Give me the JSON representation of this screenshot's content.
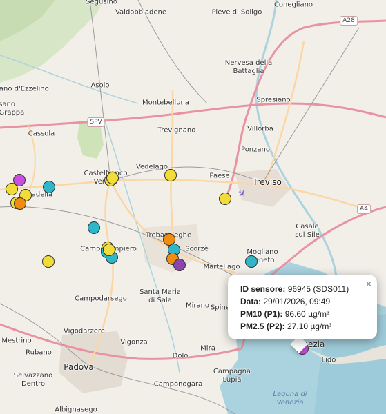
{
  "places": [
    {
      "name": "Segusino"
    },
    {
      "name": "Valdobbiadene"
    },
    {
      "name": "Pieve di Soligo"
    },
    {
      "name": "Conegliano"
    },
    {
      "name": "rmano d'Ezzelino"
    },
    {
      "name": "Asolo"
    },
    {
      "name": "Nervesa della Battaglia"
    },
    {
      "name": "Bassano del Grappa"
    },
    {
      "name": "Montebelluna"
    },
    {
      "name": "Spresiano"
    },
    {
      "name": "Cassola"
    },
    {
      "name": "Trevignano"
    },
    {
      "name": "Villorba"
    },
    {
      "name": "Ponzano"
    },
    {
      "name": "Vedelago"
    },
    {
      "name": "Castelfranco Veneto"
    },
    {
      "name": "Paese"
    },
    {
      "name": "Treviso"
    },
    {
      "name": "ttadella"
    },
    {
      "name": "Casale sul Sile"
    },
    {
      "name": "Trebaseleghe"
    },
    {
      "name": "Camposampiero"
    },
    {
      "name": "Scorzè"
    },
    {
      "name": "Mogliano Veneto"
    },
    {
      "name": "Martellago"
    },
    {
      "name": "Santa Maria di Sala"
    },
    {
      "name": "Campodarsego"
    },
    {
      "name": "Mirano"
    },
    {
      "name": "Spinea"
    },
    {
      "name": "Vigodarzere"
    },
    {
      "name": "Vigonza"
    },
    {
      "name": "Dolo"
    },
    {
      "name": "Mira"
    },
    {
      "name": "Mestrino"
    },
    {
      "name": "Rubano"
    },
    {
      "name": "Padova"
    },
    {
      "name": "Selvazzano Dentro"
    },
    {
      "name": "Campagna Lupia"
    },
    {
      "name": "Camponogara"
    },
    {
      "name": "Venezia"
    },
    {
      "name": "Lido"
    },
    {
      "name": "Albignasego"
    },
    {
      "name": "Laguna di Venezia"
    }
  ],
  "road_shields": [
    "A28",
    "SPV",
    "A4"
  ],
  "colors": {
    "yellow": "#f2dc3a",
    "orange": "#f28c0f",
    "cyan": "#2fb7c9",
    "magenta": "#c84fe0",
    "purple": "#8e44ad",
    "water": "#aad3df"
  },
  "markers": [
    {
      "color": "magenta"
    },
    {
      "color": "yellow"
    },
    {
      "color": "yellow"
    },
    {
      "color": "yellow"
    },
    {
      "color": "orange"
    },
    {
      "color": "cyan"
    },
    {
      "color": "yellow"
    },
    {
      "color": "yellow"
    },
    {
      "color": "yellow"
    },
    {
      "color": "yellow"
    },
    {
      "color": "cyan"
    },
    {
      "color": "yellow"
    },
    {
      "color": "yellow"
    },
    {
      "color": "cyan"
    },
    {
      "color": "cyan"
    },
    {
      "color": "yellow"
    },
    {
      "color": "orange"
    },
    {
      "color": "cyan"
    },
    {
      "color": "orange"
    },
    {
      "color": "purple"
    },
    {
      "color": "cyan"
    },
    {
      "color": "magenta"
    }
  ],
  "popup": {
    "id_label": "ID sensore:",
    "id_value": "96945 (SDS011)",
    "date_label": "Data:",
    "date_value": "29/01/2026, 09:49",
    "pm10_label": "PM10 (P1):",
    "pm10_value": "96.60 µg/m³",
    "pm25_label": "PM2.5 (P2):",
    "pm25_value": "27.10 µg/m³",
    "close_symbol": "×"
  },
  "icons": {
    "airport": "airport-icon"
  }
}
